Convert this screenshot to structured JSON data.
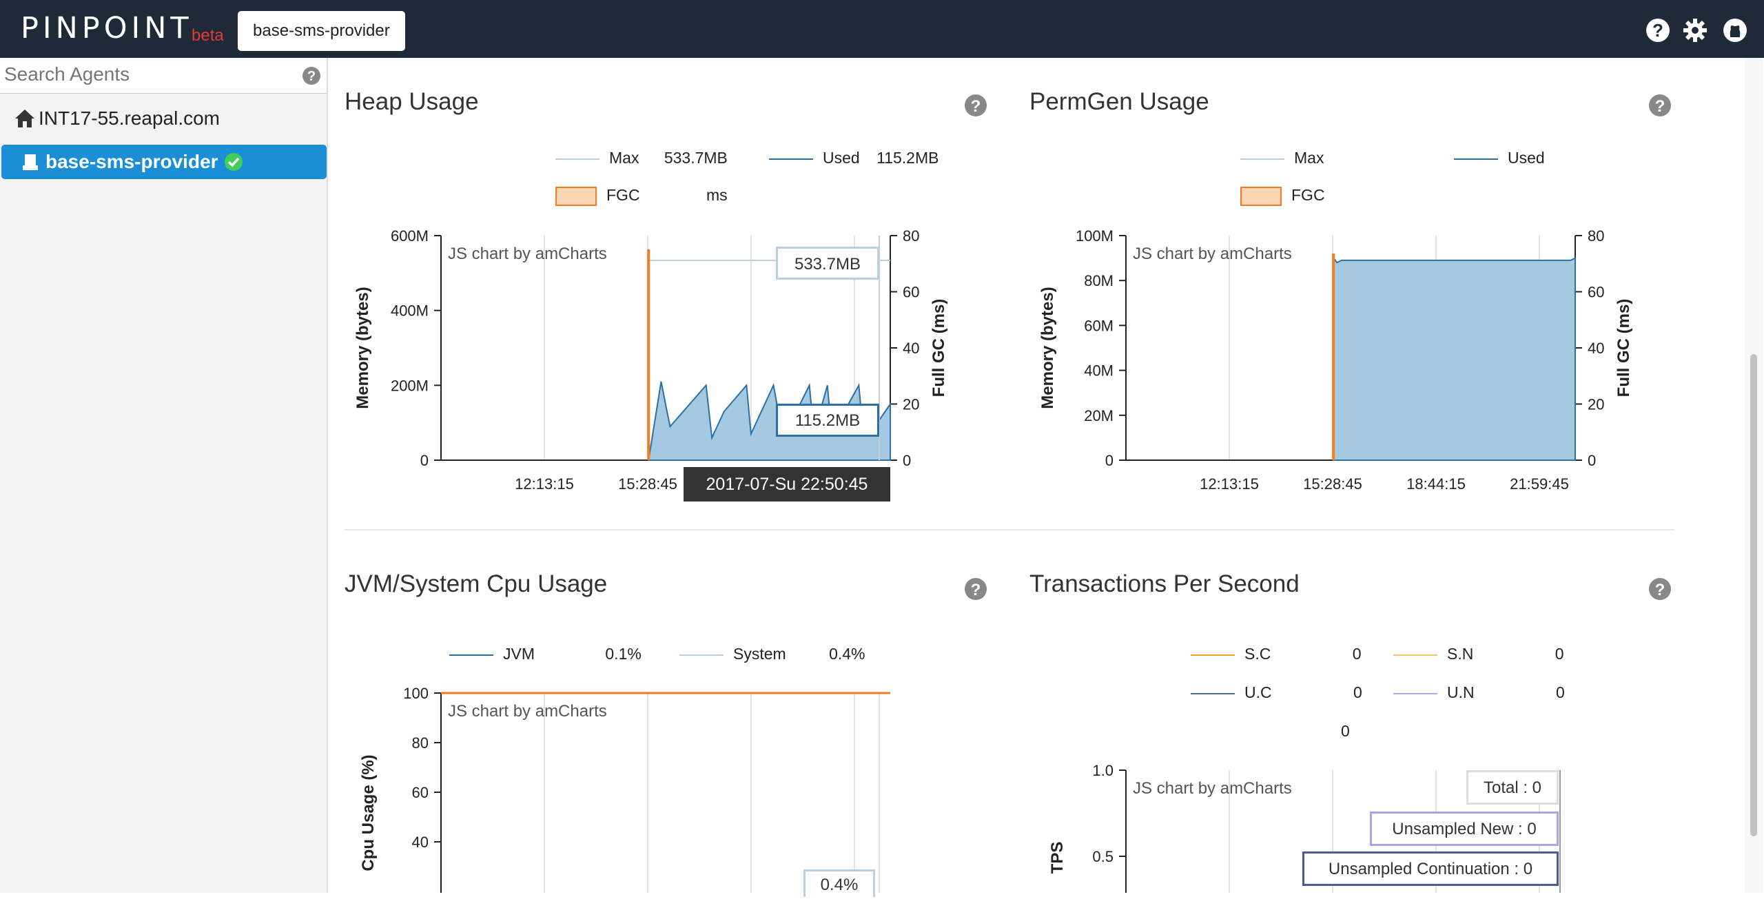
{
  "header": {
    "logo": "PINPOINT",
    "beta": "beta",
    "app_button": "base-sms-provider"
  },
  "sidebar": {
    "search_placeholder": "Search Agents",
    "host": "INT17-55.reapal.com",
    "selected_agent": "base-sms-provider"
  },
  "watermark_text": "chart",
  "heap": {
    "title": "Heap Usage",
    "legend": {
      "max_label": "Max",
      "max_value": "533.7MB",
      "used_label": "Used",
      "used_value": "115.2MB",
      "fgc_label": "FGC",
      "fgc_unit": "ms"
    },
    "balloon_max": "533.7MB",
    "balloon_used": "115.2MB",
    "cursor_time": "2017-07-Su 22:50:45"
  },
  "permgen": {
    "title": "PermGen Usage",
    "legend": {
      "max_label": "Max",
      "used_label": "Used",
      "fgc_label": "FGC"
    }
  },
  "cpu": {
    "title": "JVM/System Cpu Usage",
    "legend": {
      "jvm_label": "JVM",
      "jvm_value": "0.1%",
      "system_label": "System",
      "system_value": "0.4%"
    },
    "balloon": "0.4%"
  },
  "tps": {
    "title": "Transactions Per Second",
    "legend": {
      "sc_label": "S.C",
      "sc_value": "0",
      "sn_label": "S.N",
      "sn_value": "0",
      "uc_label": "U.C",
      "uc_value": "0",
      "un_label": "U.N",
      "un_value": "0",
      "total_value": "0"
    },
    "balloons": {
      "total": "Total : 0",
      "unsampled_new": "Unsampled New : 0",
      "unsampled_cont": "Unsampled Continuation : 0"
    }
  },
  "colors": {
    "header_bg": "#1f2a38",
    "selected": "#1a8fd6",
    "fgc": "#f47b20",
    "area": "#a6c9e2",
    "series_line": "#2a6fa8"
  },
  "chart_data": [
    {
      "type": "area",
      "title": "Heap Usage",
      "ylabel": "Memory (bytes)",
      "y2label": "Full GC (ms)",
      "ylim": [
        0,
        600000000
      ],
      "y_ticks": [
        "0",
        "200M",
        "400M",
        "600M"
      ],
      "y2lim": [
        0,
        80
      ],
      "y2_ticks": [
        "0",
        "20",
        "40",
        "60",
        "80"
      ],
      "x_ticks": [
        "12:13:15",
        "15:28:45"
      ],
      "attribution": "JS chart by amCharts",
      "x": [
        0.462,
        0.47,
        0.49,
        0.503,
        0.51,
        0.59,
        0.603,
        0.63,
        0.68,
        0.69,
        0.74,
        0.76,
        0.77,
        0.82,
        0.83,
        0.86,
        0.87,
        0.93,
        0.94,
        0.96,
        1.0
      ],
      "series": [
        {
          "name": "Used",
          "values": [
            0,
            60,
            210,
            130,
            90,
            200,
            60,
            130,
            200,
            70,
            200,
            70,
            80,
            200,
            70,
            200,
            70,
            200,
            70,
            80,
            150
          ]
        },
        {
          "name": "Max",
          "values": [
            533.7,
            533.7,
            533.7,
            533.7,
            533.7,
            533.7,
            533.7,
            533.7,
            533.7,
            533.7,
            533.7,
            533.7,
            533.7,
            533.7,
            533.7,
            533.7,
            533.7,
            533.7,
            533.7,
            533.7,
            533.7
          ]
        }
      ],
      "grid": true
    },
    {
      "type": "area",
      "title": "PermGen Usage",
      "ylabel": "Memory (bytes)",
      "y2label": "Full GC (ms)",
      "ylim": [
        0,
        100000000
      ],
      "y_ticks": [
        "0",
        "20M",
        "40M",
        "60M",
        "80M",
        "100M"
      ],
      "y2lim": [
        0,
        80
      ],
      "y2_ticks": [
        "0",
        "20",
        "40",
        "60",
        "80"
      ],
      "x_ticks": [
        "12:13:15",
        "15:28:45",
        "18:44:15",
        "21:59:45"
      ],
      "attribution": "JS chart by amCharts",
      "x": [
        0.462,
        0.47,
        0.48,
        0.99,
        1.0
      ],
      "series": [
        {
          "name": "Used",
          "values": [
            90,
            88,
            89,
            89,
            90
          ]
        }
      ],
      "grid": true
    },
    {
      "type": "line",
      "title": "JVM/System Cpu Usage",
      "ylabel": "Cpu Usage (%)",
      "ylim": [
        0,
        100
      ],
      "y_ticks": [
        "40",
        "60",
        "80",
        "100"
      ],
      "attribution": "JS chart by amCharts",
      "series": [
        {
          "name": "JVM",
          "values": [
            0.1
          ]
        },
        {
          "name": "System",
          "values": [
            0.4
          ]
        }
      ],
      "grid": true
    },
    {
      "type": "line",
      "title": "Transactions Per Second",
      "ylabel": "TPS",
      "ylim": [
        0,
        1.0
      ],
      "y_ticks": [
        "0.5",
        "1.0"
      ],
      "attribution": "JS chart by amCharts",
      "series": [
        {
          "name": "S.C",
          "values": [
            0
          ]
        },
        {
          "name": "S.N",
          "values": [
            0
          ]
        },
        {
          "name": "U.C",
          "values": [
            0
          ]
        },
        {
          "name": "U.N",
          "values": [
            0
          ]
        }
      ],
      "grid": true
    }
  ]
}
